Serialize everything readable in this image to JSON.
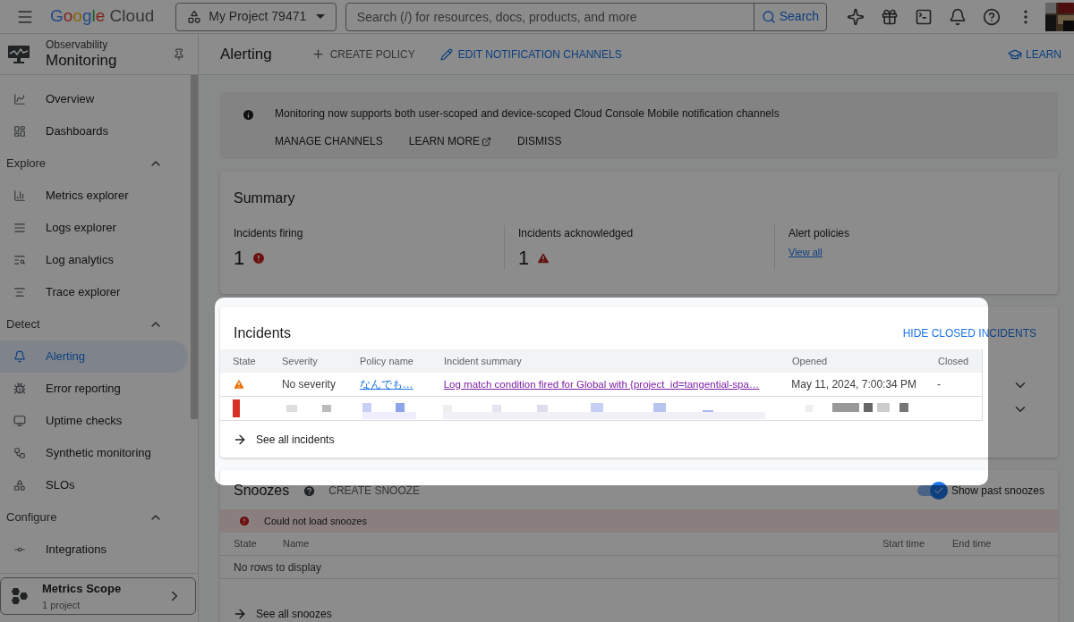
{
  "topbar": {
    "product": "Google Cloud",
    "project": "My Project 79471",
    "search": {
      "placeholder": "Search (/) for resources, docs, products, and more",
      "button": "Search"
    }
  },
  "sidebar": {
    "section_label": "Observability",
    "title": "Monitoring",
    "items": [
      {
        "kind": "link",
        "label": "Overview",
        "selected": false
      },
      {
        "kind": "link",
        "label": "Dashboards",
        "selected": false
      },
      {
        "kind": "header",
        "label": "Explore",
        "expanded": true
      },
      {
        "kind": "link",
        "label": "Metrics explorer",
        "selected": false
      },
      {
        "kind": "link",
        "label": "Logs explorer",
        "selected": false
      },
      {
        "kind": "link",
        "label": "Log analytics",
        "selected": false
      },
      {
        "kind": "link",
        "label": "Trace explorer",
        "selected": false
      },
      {
        "kind": "header",
        "label": "Detect",
        "expanded": true
      },
      {
        "kind": "link",
        "label": "Alerting",
        "selected": true
      },
      {
        "kind": "link",
        "label": "Error reporting",
        "selected": false
      },
      {
        "kind": "link",
        "label": "Uptime checks",
        "selected": false
      },
      {
        "kind": "link",
        "label": "Synthetic monitoring",
        "selected": false
      },
      {
        "kind": "link",
        "label": "SLOs",
        "selected": false
      },
      {
        "kind": "header",
        "label": "Configure",
        "expanded": true
      },
      {
        "kind": "link",
        "label": "Integrations",
        "selected": false
      }
    ],
    "scope": {
      "title": "Metrics Scope",
      "subtitle": "1 project"
    }
  },
  "header": {
    "title": "Alerting",
    "actions": [
      {
        "kind": "create",
        "label": "CREATE POLICY"
      },
      {
        "kind": "edit",
        "label": "EDIT NOTIFICATION CHANNELS"
      }
    ],
    "learn": "LEARN"
  },
  "banner": {
    "message": "Monitoring now supports both user-scoped and device-scoped Cloud Console Mobile notification channels",
    "actions": [
      {
        "label": "MANAGE CHANNELS",
        "external": false
      },
      {
        "label": "LEARN MORE",
        "external": true
      },
      {
        "label": "DISMISS",
        "external": false
      }
    ]
  },
  "summary": {
    "title": "Summary",
    "stats": [
      {
        "kind": "error",
        "label": "Incidents firing",
        "value": "1"
      },
      {
        "kind": "warning",
        "label": "Incidents acknowledged",
        "value": "1"
      },
      {
        "kind": "link",
        "label": "Alert policies",
        "value": "View all"
      }
    ]
  },
  "incidents": {
    "title": "Incidents",
    "toggle": "HIDE CLOSED INCIDENTS",
    "columns": [
      "State",
      "Severity",
      "Policy name",
      "Incident summary",
      "Opened",
      "Closed"
    ],
    "rows": [
      {
        "kind": "incident",
        "severity": "No severity",
        "policy": "なんでも…",
        "summary": "Log match condition fired for Global with {project_id=tangential-spa…",
        "opened": "May 11, 2024, 7:00:34 PM",
        "closed": "-"
      },
      {
        "kind": "redacted"
      }
    ],
    "footer": "See all incidents"
  },
  "snoozes": {
    "title": "Snoozes",
    "action": "CREATE SNOOZE",
    "show_past": {
      "label": "Show past snoozes",
      "on": true
    },
    "error": "Could not load snoozes",
    "columns": [
      "State",
      "Name",
      "Start time",
      "End time"
    ],
    "empty": "No rows to display",
    "footer": "See all snoozes"
  }
}
